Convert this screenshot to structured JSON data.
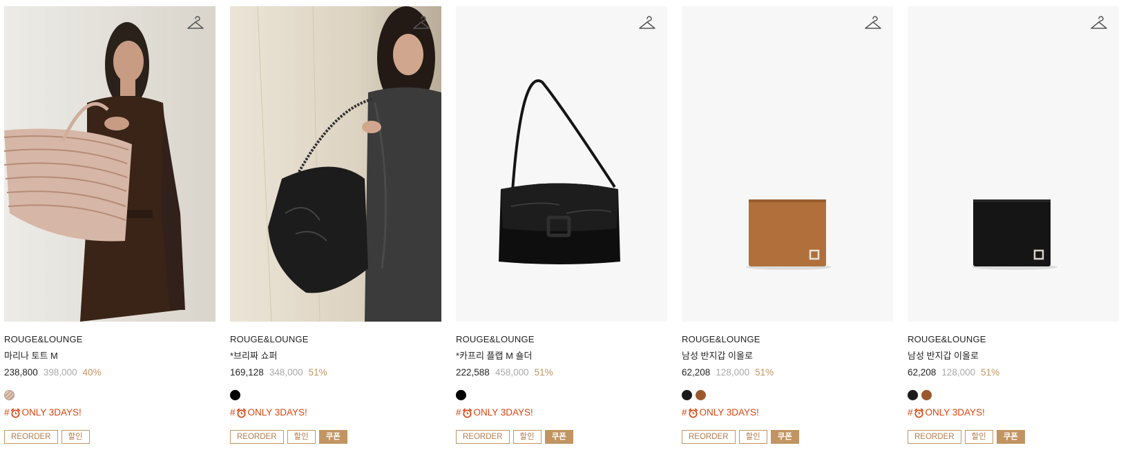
{
  "colors": {
    "accent": "#c19461",
    "promo_red": "#d9440f",
    "muted": "#a9a9a9"
  },
  "products": [
    {
      "brand": "ROUGE&LOUNGE",
      "name": "마리나 토트 M",
      "price": "238,800",
      "original_price": "398,000",
      "discount": "40%",
      "swatches": [
        {
          "color": "pattern-beige"
        }
      ],
      "promo_prefix": "#",
      "promo_icon": "alarm-clock-icon",
      "promo_text": "ONLY 3DAYS!",
      "tags": [
        "REORDER",
        "할인"
      ]
    },
    {
      "brand": "ROUGE&LOUNGE",
      "name": "*브리짜 쇼퍼",
      "price": "169,128",
      "original_price": "348,000",
      "discount": "51%",
      "swatches": [
        {
          "color": "#000000"
        }
      ],
      "promo_prefix": "#",
      "promo_icon": "alarm-clock-icon",
      "promo_text": "ONLY 3DAYS!",
      "tags": [
        "REORDER",
        "할인",
        "쿠폰"
      ]
    },
    {
      "brand": "ROUGE&LOUNGE",
      "name": "*카프리 플랩 M 숄더",
      "price": "222,588",
      "original_price": "458,000",
      "discount": "51%",
      "swatches": [
        {
          "color": "#000000"
        }
      ],
      "promo_prefix": "#",
      "promo_icon": "alarm-clock-icon",
      "promo_text": "ONLY 3DAYS!",
      "tags": [
        "REORDER",
        "할인",
        "쿠폰"
      ]
    },
    {
      "brand": "ROUGE&LOUNGE",
      "name": "남성 반지갑 이올로",
      "price": "62,208",
      "original_price": "128,000",
      "discount": "51%",
      "swatches": [
        {
          "color": "#1a1a1a"
        },
        {
          "color": "#9b5a2e"
        }
      ],
      "promo_prefix": "#",
      "promo_icon": "alarm-clock-icon",
      "promo_text": "ONLY 3DAYS!",
      "tags": [
        "REORDER",
        "할인",
        "쿠폰"
      ]
    },
    {
      "brand": "ROUGE&LOUNGE",
      "name": "남성 반지갑 이올로",
      "price": "62,208",
      "original_price": "128,000",
      "discount": "51%",
      "swatches": [
        {
          "color": "#1a1a1a"
        },
        {
          "color": "#9b5a2e"
        }
      ],
      "promo_prefix": "#",
      "promo_icon": "alarm-clock-icon",
      "promo_text": "ONLY 3DAYS!",
      "tags": [
        "REORDER",
        "할인",
        "쿠폰"
      ]
    }
  ]
}
